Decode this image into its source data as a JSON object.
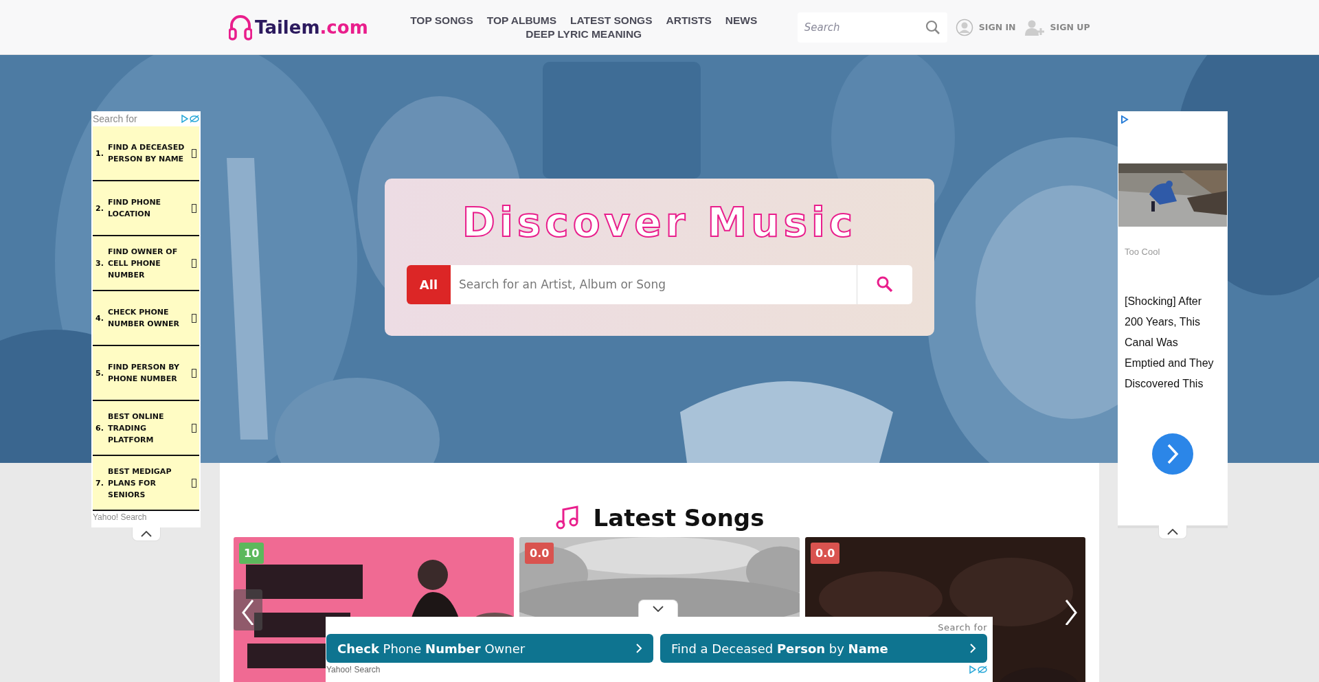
{
  "header": {
    "logo": {
      "name": "Tailem",
      "domain": ".com"
    },
    "nav": [
      "TOP SONGS",
      "TOP ALBUMS",
      "LATEST SONGS",
      "ARTISTS",
      "NEWS",
      "DEEP LYRIC MEANING"
    ],
    "search": {
      "placeholder": "Search"
    },
    "sign_in": "SIGN IN",
    "sign_up": "SIGN UP"
  },
  "hero": {
    "title": "Discover Music",
    "category": "All",
    "search_placeholder": "Search for an Artist, Album or Song"
  },
  "latest_songs": {
    "heading": "Latest Songs",
    "cards": [
      {
        "score": "10",
        "color": "#5cb85c",
        "kind": "pink"
      },
      {
        "score": "0.0",
        "color": "#d9534f",
        "kind": "grey"
      },
      {
        "score": "0.0",
        "color": "#d9534f",
        "kind": "dark"
      }
    ]
  },
  "left_ad": {
    "header": "Search for",
    "footer": "Yahoo! Search",
    "items": [
      {
        "number": "1.",
        "text": "FIND A DECEASED PERSON BY NAME"
      },
      {
        "number": "2.",
        "text": "FIND PHONE LOCATION"
      },
      {
        "number": "3.",
        "text": "FIND OWNER OF CELL PHONE NUMBER"
      },
      {
        "number": "4.",
        "text": "CHECK PHONE NUMBER OWNER"
      },
      {
        "number": "5.",
        "text": "FIND PERSON BY PHONE NUMBER"
      },
      {
        "number": "6.",
        "text": "BEST ONLINE TRADING PLATFORM"
      },
      {
        "number": "7.",
        "text": "BEST MEDIGAP PLANS FOR SENIORS"
      }
    ]
  },
  "right_ad": {
    "source": "Too Cool",
    "headline": "[Shocking] After 200 Years, This Canal Was Emptied and They Discovered This"
  },
  "bottom_ad": {
    "header": "Search for",
    "footer": "Yahoo! Search",
    "links": [
      "**Check** Phone **Number** Owner",
      "Find a Deceased **Person** by **Name**"
    ]
  }
}
